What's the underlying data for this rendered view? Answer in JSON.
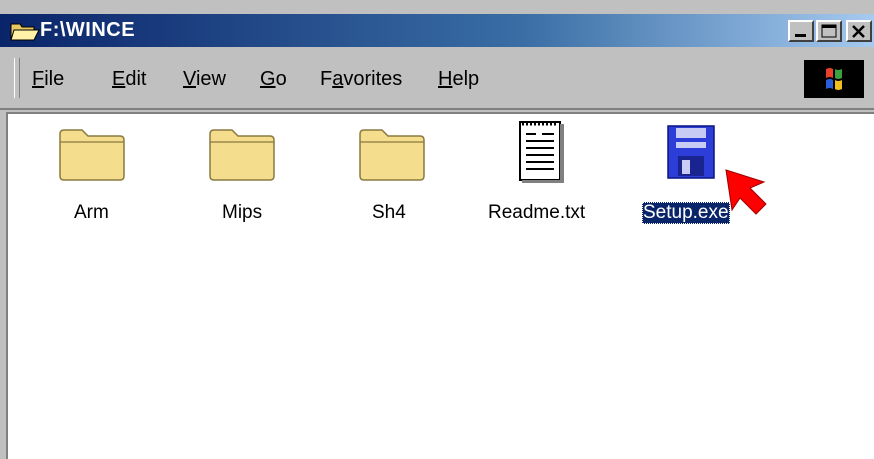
{
  "window": {
    "title": "F:\\WINCE"
  },
  "menu": {
    "file": {
      "access": "F",
      "rest": "ile"
    },
    "edit": {
      "access": "E",
      "rest": "dit"
    },
    "view": {
      "access": "V",
      "rest": "iew"
    },
    "go": {
      "access": "G",
      "rest": "o"
    },
    "favorites": {
      "pre": "F",
      "access": "a",
      "rest": "vorites"
    },
    "help": {
      "access": "H",
      "rest": "elp"
    }
  },
  "files": [
    {
      "name": "Arm",
      "icon": "folder-icon"
    },
    {
      "name": "Mips",
      "icon": "folder-icon"
    },
    {
      "name": "Sh4",
      "icon": "folder-icon"
    },
    {
      "name": "Readme.txt",
      "icon": "text-document-icon"
    },
    {
      "name": "Setup.exe",
      "icon": "floppy-disk-icon",
      "selected": true
    }
  ],
  "colors": {
    "title_active": "#0a246a",
    "selection": "#0a246a",
    "cursor": "#ff0000"
  }
}
